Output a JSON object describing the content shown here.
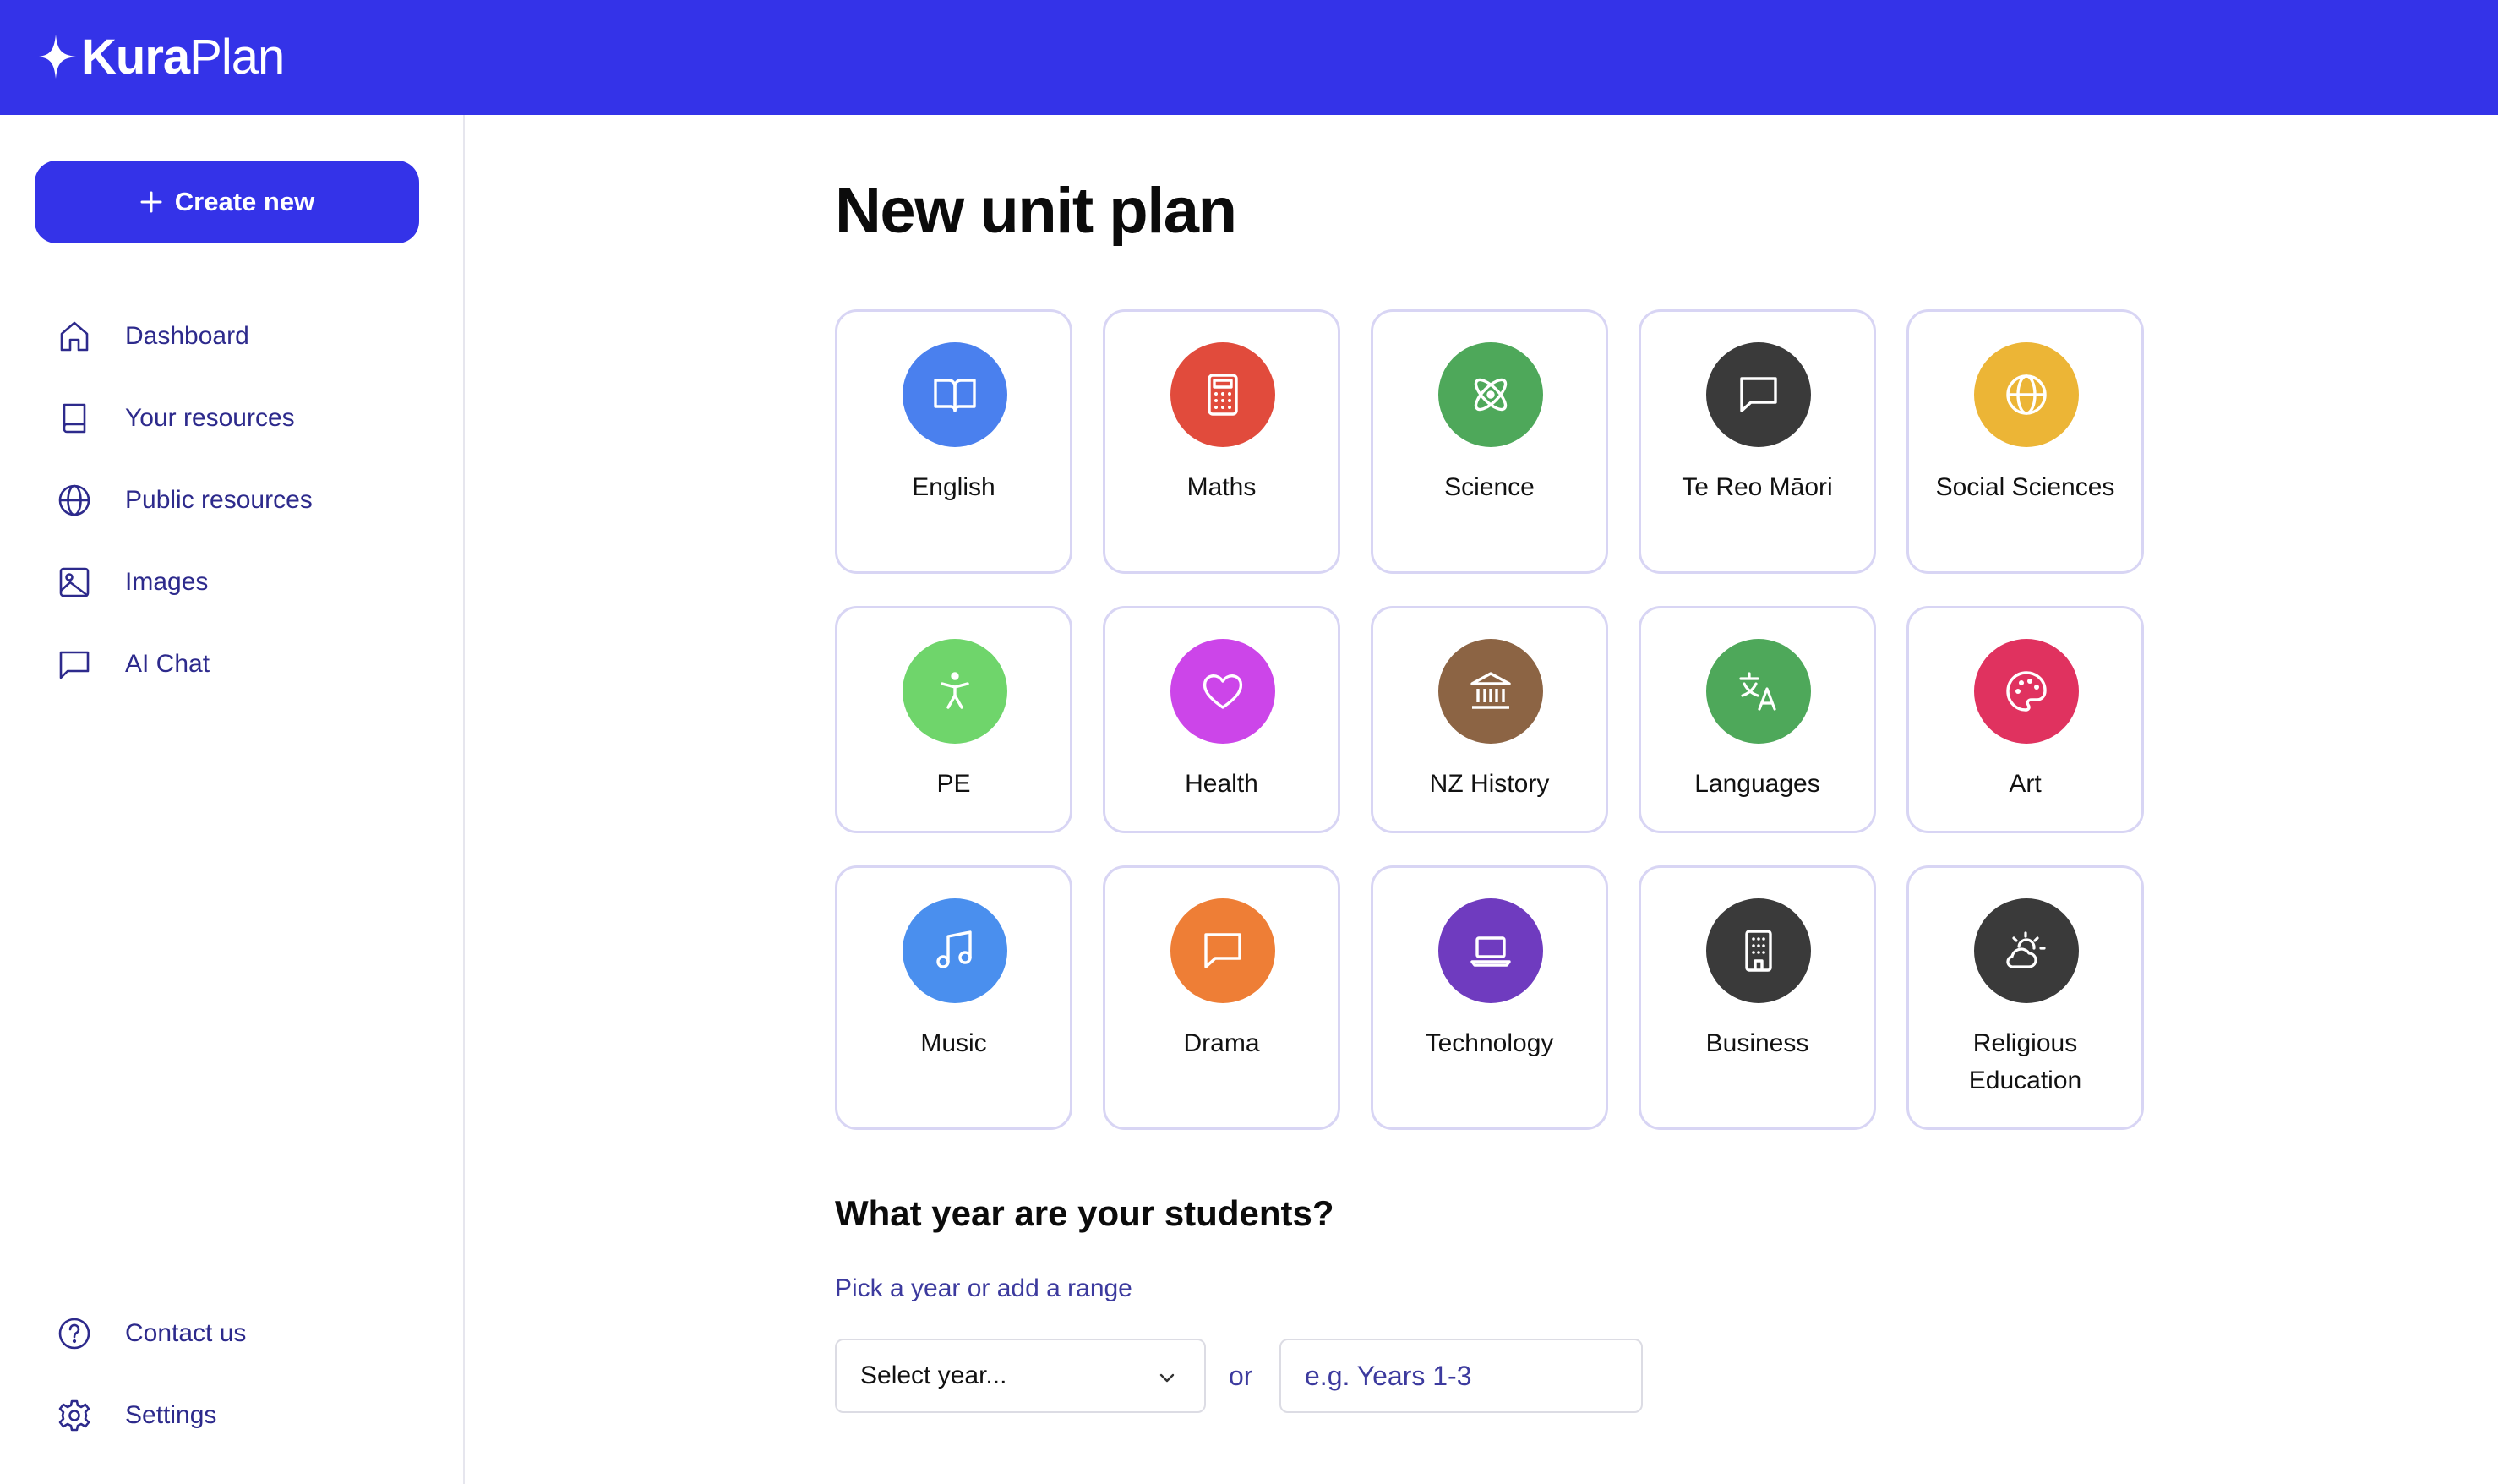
{
  "brand": {
    "name_bold": "Kura",
    "name_light": "Plan",
    "primary_color": "#3433e8"
  },
  "sidebar": {
    "create_label": "Create new",
    "items": [
      {
        "label": "Dashboard",
        "icon": "home-icon"
      },
      {
        "label": "Your resources",
        "icon": "book-icon"
      },
      {
        "label": "Public resources",
        "icon": "globe-icon"
      },
      {
        "label": "Images",
        "icon": "image-icon"
      },
      {
        "label": "AI Chat",
        "icon": "chat-icon"
      }
    ],
    "footer_items": [
      {
        "label": "Contact us",
        "icon": "help-circle-icon"
      },
      {
        "label": "Settings",
        "icon": "gear-icon"
      }
    ]
  },
  "main": {
    "title": "New unit plan",
    "subjects": [
      {
        "label": "English",
        "icon": "open-book-icon",
        "color": "#4a80ee"
      },
      {
        "label": "Maths",
        "icon": "calculator-icon",
        "color": "#e14b3c"
      },
      {
        "label": "Science",
        "icon": "atom-icon",
        "color": "#4ea85a"
      },
      {
        "label": "Te Reo Māori",
        "icon": "speech-bubble-icon",
        "color": "#3a3a3a"
      },
      {
        "label": "Social Sciences",
        "icon": "globe-icon",
        "color": "#ecb536"
      },
      {
        "label": "PE",
        "icon": "person-icon",
        "color": "#6fd56b"
      },
      {
        "label": "Health",
        "icon": "heart-icon",
        "color": "#cc45e9"
      },
      {
        "label": "NZ History",
        "icon": "landmark-icon",
        "color": "#8c6444"
      },
      {
        "label": "Languages",
        "icon": "translate-icon",
        "color": "#4ea85a"
      },
      {
        "label": "Art",
        "icon": "palette-icon",
        "color": "#e0325f"
      },
      {
        "label": "Music",
        "icon": "music-note-icon",
        "color": "#4a8fee"
      },
      {
        "label": "Drama",
        "icon": "speech-bubble-icon",
        "color": "#ee7e36"
      },
      {
        "label": "Technology",
        "icon": "laptop-icon",
        "color": "#6f3bbf"
      },
      {
        "label": "Business",
        "icon": "building-icon",
        "color": "#3a3a3a"
      },
      {
        "label": "Religious Education",
        "icon": "sun-cloud-icon",
        "color": "#3a3a3a"
      }
    ],
    "year_section": {
      "title": "What year are your students?",
      "subtitle": "Pick a year or add a range",
      "select_value": "Select year...",
      "or_label": "or",
      "range_placeholder": "e.g. Years 1-3"
    }
  }
}
